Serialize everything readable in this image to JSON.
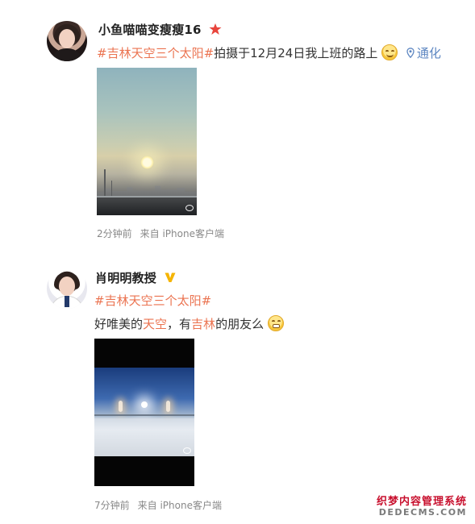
{
  "posts": [
    {
      "username": "小鱼喵喵变瘦瘦16",
      "badge_icon": "red-star-icon",
      "text": {
        "hashtag": "#吉林天空三个太阳#",
        "body": "拍摄于12月24日我上班的路上",
        "emoji": "smile-emoji",
        "location": "通化"
      },
      "photo": "sunrise-over-city-road-photo",
      "time": "2分钟前",
      "source": "来自 iPhone客户端"
    },
    {
      "username": "肖明明教授",
      "badge_icon": "verified-v-icon",
      "text": {
        "hashtag": "#吉林天空三个太阳#",
        "body_1": "好唯美的",
        "body_red_1": "天空",
        "body_2": "，有",
        "body_red_2": "吉林",
        "body_3": "的朋友么",
        "emoji": "grin-emoji"
      },
      "photo": "three-suns-snowfield-photo",
      "time": "7分钟前",
      "source": "来自 iPhone客户端"
    }
  ],
  "watermark": {
    "cn": "织梦内容管理系统",
    "en": "DEDECMS.COM"
  },
  "colors": {
    "hashtag": "#eb7350",
    "location": "#5d86c1",
    "meta": "#888888",
    "watermark_red": "#c8102e"
  }
}
